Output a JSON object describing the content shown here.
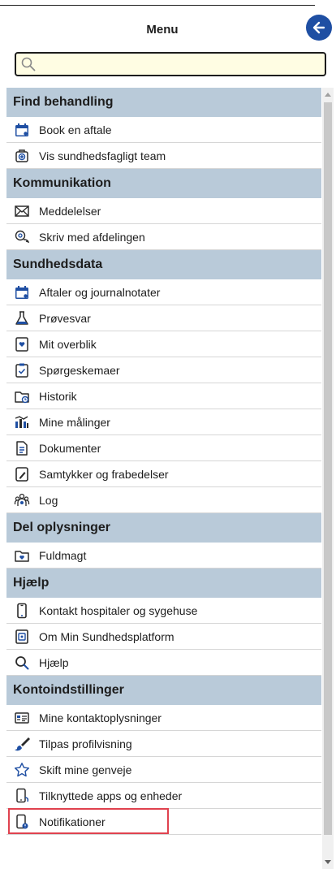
{
  "header": {
    "title": "Menu",
    "back_icon": "arrow-left-circle-icon"
  },
  "search": {
    "placeholder": "",
    "value": "",
    "icon": "search-icon"
  },
  "colors": {
    "section_bg": "#b9cad9",
    "accent": "#1f4fa3",
    "highlight": "#e0424f",
    "search_bg": "#fffde3"
  },
  "sections": [
    {
      "title": "Find behandling",
      "items": [
        {
          "label": "Book en aftale",
          "icon": "calendar-icon"
        },
        {
          "label": "Vis sundhedsfagligt team",
          "icon": "medical-team-icon"
        }
      ]
    },
    {
      "title": "Kommunikation",
      "items": [
        {
          "label": "Meddelelser",
          "icon": "envelope-icon"
        },
        {
          "label": "Skriv med afdelingen",
          "icon": "chat-icon"
        }
      ]
    },
    {
      "title": "Sundhedsdata",
      "items": [
        {
          "label": "Aftaler og journalnotater",
          "icon": "calendar-icon"
        },
        {
          "label": "Prøvesvar",
          "icon": "flask-icon"
        },
        {
          "label": "Mit overblik",
          "icon": "heart-card-icon"
        },
        {
          "label": "Spørgeskemaer",
          "icon": "checklist-icon"
        },
        {
          "label": "Historik",
          "icon": "folder-clock-icon"
        },
        {
          "label": "Mine målinger",
          "icon": "measurements-icon"
        },
        {
          "label": "Dokumenter",
          "icon": "document-icon"
        },
        {
          "label": "Samtykker og frabedelser",
          "icon": "consent-icon"
        },
        {
          "label": "Log",
          "icon": "people-log-icon"
        }
      ]
    },
    {
      "title": "Del oplysninger",
      "items": [
        {
          "label": "Fuldmagt",
          "icon": "folder-heart-icon"
        }
      ]
    },
    {
      "title": "Hjælp",
      "items": [
        {
          "label": "Kontakt hospitaler og sygehuse",
          "icon": "phone-icon"
        },
        {
          "label": "Om Min Sundhedsplatform",
          "icon": "info-box-icon"
        },
        {
          "label": "Hjælp",
          "icon": "search-icon"
        }
      ]
    },
    {
      "title": "Kontoindstillinger",
      "items": [
        {
          "label": "Mine kontaktoplysninger",
          "icon": "contact-card-icon"
        },
        {
          "label": "Tilpas profilvisning",
          "icon": "brush-icon"
        },
        {
          "label": "Skift mine genveje",
          "icon": "star-icon"
        },
        {
          "label": "Tilknyttede apps og enheder",
          "icon": "device-link-icon"
        },
        {
          "label": "Notifikationer",
          "icon": "notification-device-icon",
          "highlighted": true
        }
      ]
    }
  ]
}
